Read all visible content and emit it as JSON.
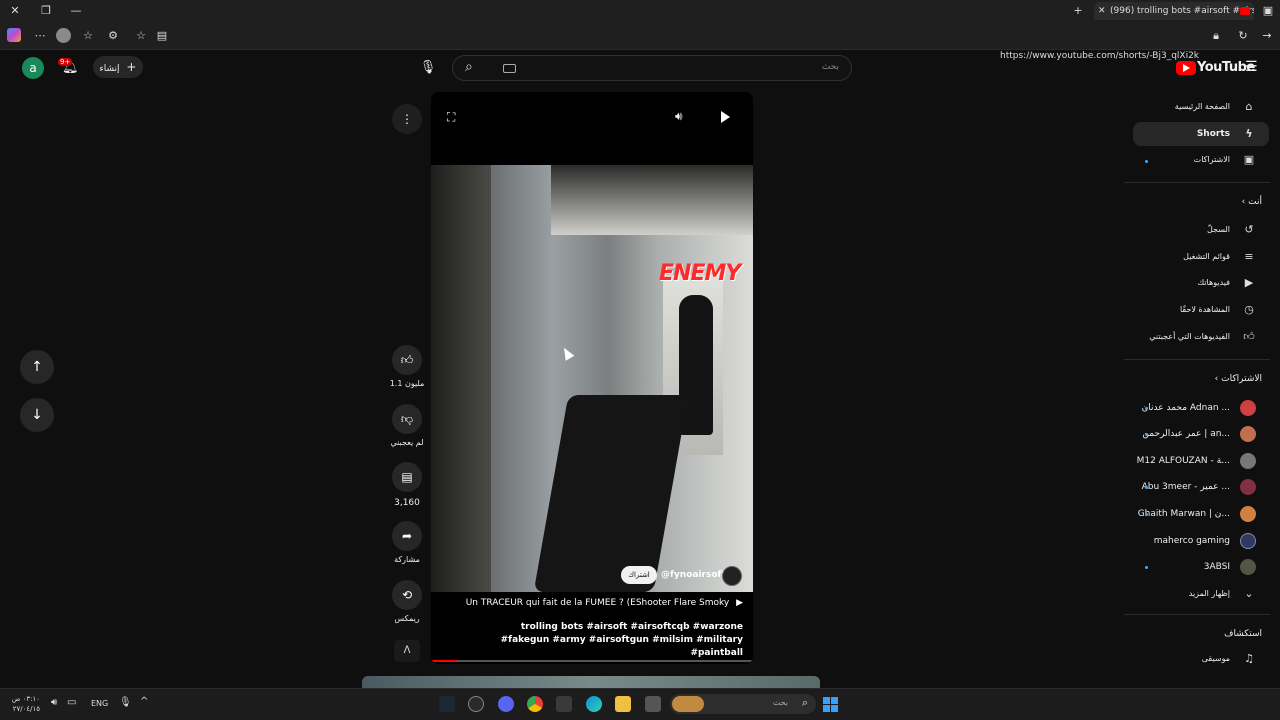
{
  "browser": {
    "tab_title": "(996) trolling bots #airsoft #airsoft",
    "url": "https://www.youtube.com/shorts/-Bj3_qlXi2k"
  },
  "header": {
    "create_label": "إنشاء",
    "notification_count": "9+",
    "avatar_letter": "a",
    "search_placeholder": "بحث",
    "logo_text": "YouTube"
  },
  "sidebar": {
    "main": [
      {
        "label": "الصفحة الرئيسية",
        "icon": "home-icon"
      },
      {
        "label": "Shorts",
        "icon": "shorts-icon"
      },
      {
        "label": "الاشتراكات",
        "icon": "subscriptions-icon"
      }
    ],
    "you_title": "أنت",
    "you_items": [
      {
        "label": "السجلّ",
        "icon": "history-icon"
      },
      {
        "label": "قوائم التشغيل",
        "icon": "playlists-icon"
      },
      {
        "label": "فيديوهاتك",
        "icon": "your-videos-icon"
      },
      {
        "label": "المشاهدة لاحقًا",
        "icon": "watch-later-icon"
      },
      {
        "label": "الفيديوهات التي أعجبتني",
        "icon": "liked-icon"
      }
    ],
    "subs_title": "الاشتراكات",
    "subscriptions": [
      {
        "label": "محمد عدنان Adnan ...",
        "color": "#d04040"
      },
      {
        "label": "عمر عبدالرحمن | an...",
        "color": "#c07050"
      },
      {
        "label": "M12 ALFOUZAN - ﺔ...",
        "color": "#777777"
      },
      {
        "label": "Abu 3meer - عمير ...",
        "color": "#803040"
      },
      {
        "label": "Ghaith Marwan | ن...",
        "color": "#d08040"
      },
      {
        "label": "maherco gaming",
        "color": "#303a60"
      },
      {
        "label": "3ABSI",
        "color": "#555544"
      }
    ],
    "show_more": "إظهار المزيد",
    "explore_title": "استكشاف",
    "explore_items": [
      {
        "label": "موسيقى",
        "icon": "music-icon"
      }
    ]
  },
  "video": {
    "overlay_text": "ENEMY",
    "channel": "@fynoairsoft",
    "subscribe": "اشتراك",
    "title": "Un TRACEUR qui fait de la FUMÉE ? (EShooter Flare Smoky",
    "description": "trolling bots #airsoft #airsoftcqb #warzone #fakegun #army #airsoftgun #milsim #military #paintball"
  },
  "actions": {
    "likes": "1.1 مليون",
    "dislike": "لم يعجبني",
    "comments": "3,160",
    "share": "مشاركة",
    "remix": "ريمكس"
  },
  "taskbar": {
    "language": "ENG",
    "time": "٠٣:١٠ ص",
    "date": "٢٧/٠٤/١٥",
    "search_placeholder": "بحث"
  }
}
